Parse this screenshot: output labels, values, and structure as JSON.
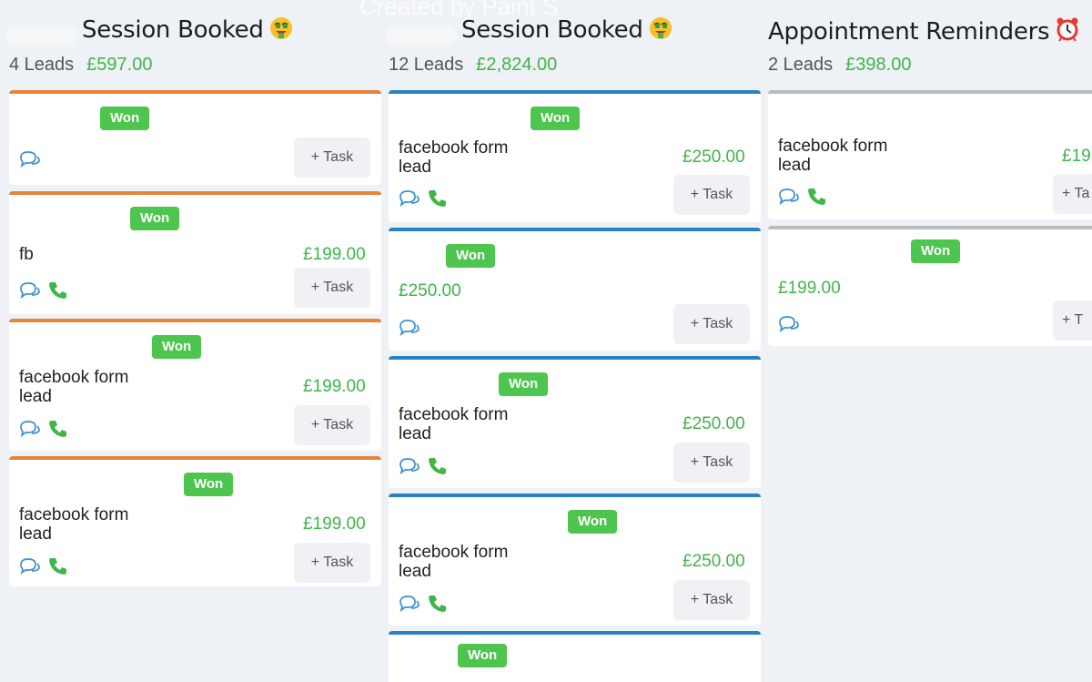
{
  "watermark": "Created by Paint S",
  "columns": [
    {
      "title": "Session Booked",
      "title_emoji": "money-mouth-face",
      "leads": "4 Leads",
      "amount": "£597.00",
      "accent": "#e8833a",
      "cards": [
        {
          "status": "Won",
          "name": "",
          "amount": "",
          "task": "+ Task",
          "icons": [
            "chat-icon"
          ]
        },
        {
          "status": "Won",
          "name": "fb",
          "amount": "£199.00",
          "task": "+ Task",
          "icons": [
            "chat-icon",
            "phone-icon"
          ]
        },
        {
          "status": "Won",
          "name": "facebook form lead",
          "amount": "£199.00",
          "task": "+ Task",
          "icons": [
            "chat-icon",
            "phone-icon"
          ]
        },
        {
          "status": "Won",
          "name": "facebook form lead",
          "amount": "£199.00",
          "task": "+ Task",
          "icons": [
            "chat-icon",
            "phone-icon"
          ]
        }
      ]
    },
    {
      "title": "Session Booked",
      "title_emoji": "money-mouth-face",
      "leads": "12 Leads",
      "amount": "£2,824.00",
      "accent": "#2a82c2",
      "cards": [
        {
          "status": "Won",
          "name": "facebook form lead",
          "amount": "£250.00",
          "task": "+ Task",
          "icons": [
            "chat-icon",
            "phone-icon"
          ]
        },
        {
          "status": "Won",
          "name": "",
          "amount": "£250.00",
          "task": "+ Task",
          "icons": [
            "chat-icon"
          ]
        },
        {
          "status": "Won",
          "name": "facebook form lead",
          "amount": "£250.00",
          "task": "+ Task",
          "icons": [
            "chat-icon",
            "phone-icon"
          ]
        },
        {
          "status": "Won",
          "name": "facebook form lead",
          "amount": "£250.00",
          "task": "+ Task",
          "icons": [
            "chat-icon",
            "phone-icon"
          ]
        },
        {
          "status": "Won",
          "name": "",
          "amount": "",
          "task": "",
          "icons": []
        }
      ]
    },
    {
      "title": "Appointment Reminders",
      "title_emoji": "alarm-clock",
      "leads": "2 Leads",
      "amount": "£398.00",
      "accent": "#b9bcbf",
      "cards": [
        {
          "status": "",
          "name": "facebook form lead",
          "amount": "£19",
          "task": "+ Ta",
          "icons": [
            "chat-icon",
            "phone-icon"
          ]
        },
        {
          "status": "Won",
          "name": "",
          "amount": "£199.00",
          "task": "+ T",
          "icons": [
            "chat-icon"
          ]
        }
      ]
    }
  ]
}
